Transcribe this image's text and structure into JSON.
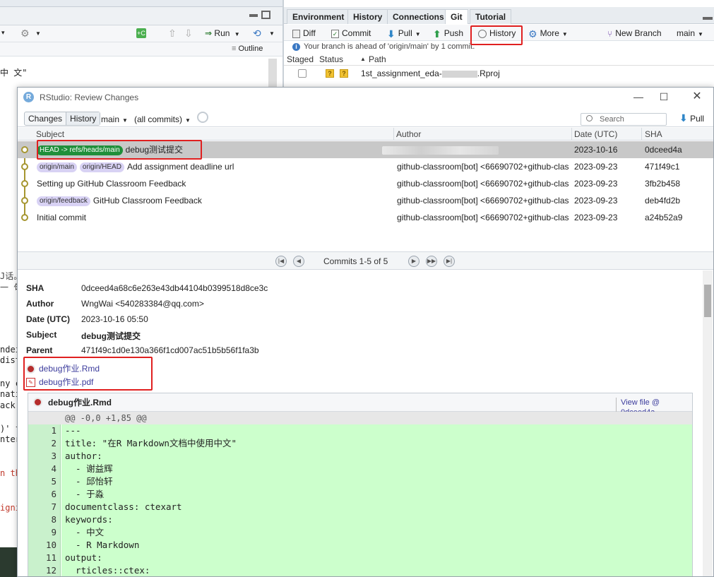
{
  "background_editor": {
    "outline_label": "Outline",
    "run_label": "Run",
    "code_fragments": [
      "中 文\"",
      "J话。",
      "一 句",
      "ndeı",
      "dist",
      "ny c",
      "nati",
      "ack",
      ")' f",
      "nter",
      "n th",
      "igni"
    ]
  },
  "git_pane": {
    "tabs": [
      "Environment",
      "History",
      "Connections",
      "Git",
      "Tutorial"
    ],
    "active_tab": "Git",
    "toolbar": {
      "diff": "Diff",
      "commit": "Commit",
      "pull": "Pull",
      "push": "Push",
      "history": "History",
      "more": "More",
      "new_branch": "New Branch",
      "branch": "main"
    },
    "ahead_message": "Your branch is ahead of 'origin/main' by 1 commit.",
    "columns": {
      "staged": "Staged",
      "status": "Status",
      "path": "Path"
    },
    "file": {
      "status": "?",
      "name_start": "1st_assignment_eda-",
      "name_end": ".Rproj"
    }
  },
  "dialog": {
    "title": "RStudio: Review Changes",
    "view_changes": "Changes",
    "view_history": "History",
    "branch": "main",
    "filter": "(all commits)",
    "search_placeholder": "Search",
    "pull": "Pull",
    "columns": {
      "subject": "Subject",
      "author": "Author",
      "date": "Date (UTC)",
      "sha": "SHA"
    },
    "commits": [
      {
        "tags": [
          "HEAD -> refs/heads/main"
        ],
        "subject": "debug测试提交",
        "author": "",
        "date": "2023-10-16",
        "sha": "0dceed4a"
      },
      {
        "tags": [
          "origin/main",
          "origin/HEAD"
        ],
        "subject": "Add assignment deadline url",
        "author": "github-classroom[bot] <66690702+github-clas",
        "date": "2023-09-23",
        "sha": "471f49c1"
      },
      {
        "tags": [],
        "subject": "Setting up GitHub Classroom Feedback",
        "author": "github-classroom[bot] <66690702+github-clas",
        "date": "2023-09-23",
        "sha": "3fb2b458"
      },
      {
        "tags": [
          "origin/feedback"
        ],
        "subject": "GitHub Classroom Feedback",
        "author": "github-classroom[bot] <66690702+github-clas",
        "date": "2023-09-23",
        "sha": "deb4fd2b"
      },
      {
        "tags": [],
        "subject": "Initial commit",
        "author": "github-classroom[bot] <66690702+github-clas",
        "date": "2023-09-23",
        "sha": "a24b52a9"
      }
    ],
    "pager_text": "Commits 1-5 of 5",
    "details": {
      "sha_label": "SHA",
      "sha": "0dceed4a68c6e263e43db44104b0399518d8ce3c",
      "author_label": "Author",
      "author": "WngWai <540283384@qq.com>",
      "date_label": "Date (UTC)",
      "date": "2023-10-16 05:50",
      "subject_label": "Subject",
      "subject": "debug测试提交",
      "parent_label": "Parent",
      "parent": "471f49c1d0e130a366f1cd007ac51b5b56f1fa3b"
    },
    "files": [
      "debug作业.Rmd",
      "debug作业.pdf"
    ],
    "diff": {
      "file": "debug作业.Rmd",
      "view_file": "View file @ 0dceed4a",
      "hunk": "@@ -0,0 +1,85 @@",
      "lines": [
        {
          "n": "1",
          "text": "---"
        },
        {
          "n": "2",
          "text": "title: \"在R Markdown文档中使用中文\""
        },
        {
          "n": "3",
          "text": "author:"
        },
        {
          "n": "4",
          "text": "  - 谢益辉"
        },
        {
          "n": "5",
          "text": "  - 邱怡轩"
        },
        {
          "n": "6",
          "text": "  - 于淼"
        },
        {
          "n": "7",
          "text": "documentclass: ctexart"
        },
        {
          "n": "8",
          "text": "keywords:"
        },
        {
          "n": "9",
          "text": "  - 中文"
        },
        {
          "n": "10",
          "text": "  - R Markdown"
        },
        {
          "n": "11",
          "text": "output:"
        },
        {
          "n": "12",
          "text": "  rticles::ctex:"
        }
      ]
    }
  },
  "colors": {
    "highlight": "#e02020",
    "head_tag": "#1f8f3a",
    "ref_tag": "#d8d2f4",
    "added_bg": "#ccffcc",
    "graph": "#a69630"
  }
}
